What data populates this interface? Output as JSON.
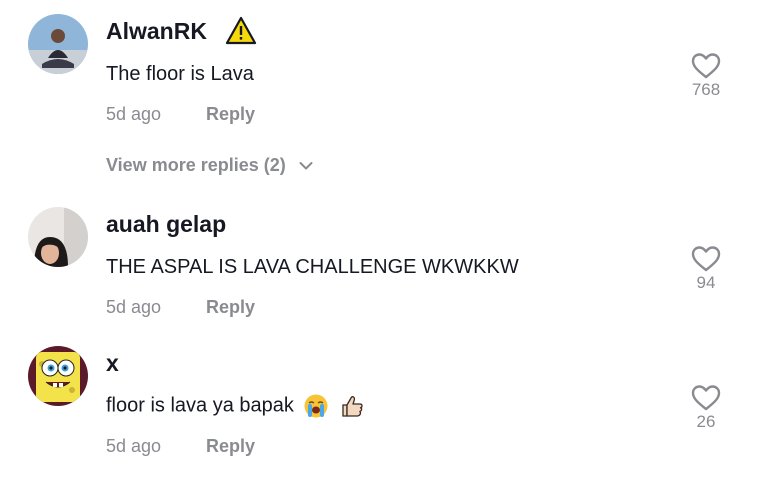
{
  "comments": [
    {
      "username": "AlwanRK",
      "text": "The floor is Lava",
      "time": "5d ago",
      "reply_label": "Reply",
      "likes": "768",
      "badge_icon": "warning-icon",
      "avatar_icon": "person-photo"
    },
    {
      "username": "auah gelap",
      "text": "THE ASPAL IS LAVA CHALLENGE WKWKKW",
      "time": "5d ago",
      "reply_label": "Reply",
      "likes": "94",
      "avatar_icon": "person-photo"
    },
    {
      "username": "x",
      "text": "floor is lava ya bapak",
      "time": "5d ago",
      "reply_label": "Reply",
      "likes": "26",
      "emojis": [
        "loudly-crying-face-icon",
        "thumbs-up-icon"
      ],
      "avatar_icon": "spongebob-avatar"
    }
  ],
  "view_more_replies": "View more replies (2)",
  "colors": {
    "text": "#161823",
    "muted": "#8a8b91",
    "warning": "#f5d90a"
  }
}
